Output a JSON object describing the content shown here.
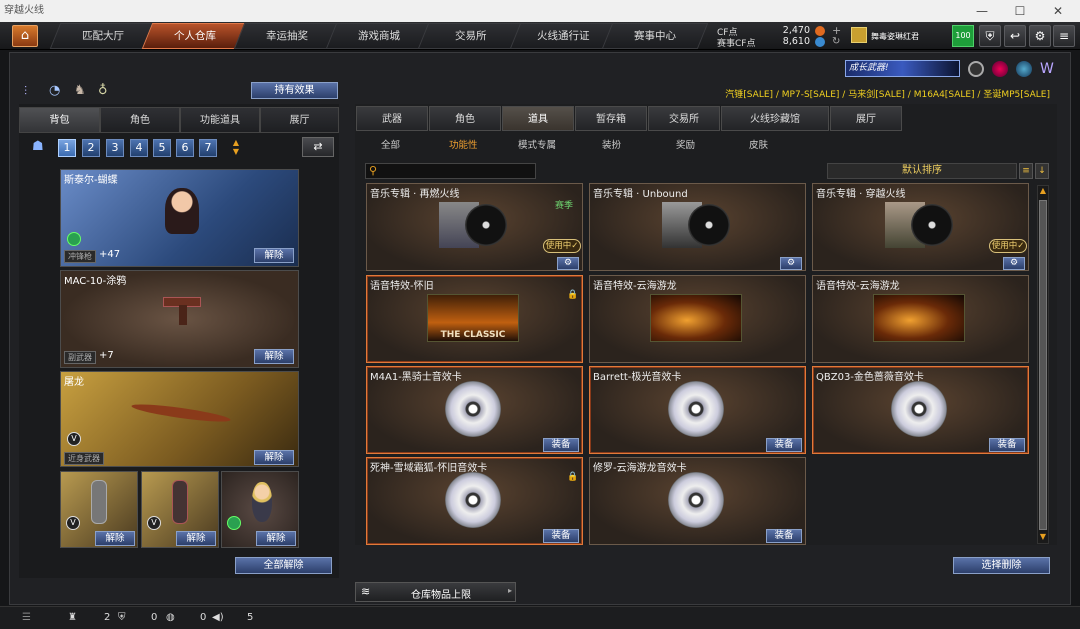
{
  "window": {
    "title": "穿越火线"
  },
  "nav": {
    "tabs": [
      "匹配大厅",
      "个人仓库",
      "幸运抽奖",
      "游戏商城",
      "交易所",
      "火线通行证",
      "赛事中心"
    ],
    "active_index": 1
  },
  "currency": {
    "cf_label": "CF点",
    "cf_value": "2,470",
    "match_label": "赛事CF点",
    "match_value": "8,610"
  },
  "user": {
    "name": "舞毒姿琳红君",
    "level": "100"
  },
  "promo": {
    "banner_text": "成长武器!",
    "sale_ticker": "汽锤[SALE] / MP7-S[SALE] / 马来剑[SALE] / M16A4[SALE] / 圣诞MP5[SALE]"
  },
  "left": {
    "effects_button": "持有效果",
    "tabs": [
      "背包",
      "角色",
      "功能道具",
      "展厅"
    ],
    "active_tab": 0,
    "pages": [
      "1",
      "2",
      "3",
      "4",
      "5",
      "6",
      "7"
    ],
    "slots": [
      {
        "title": "斯泰尔-蝴蝶",
        "tag": "冲锋枪",
        "bonus": "+47",
        "button": "解除"
      },
      {
        "title": "MAC-10-涂鸦",
        "tag": "副武器",
        "bonus": "+7",
        "button": "解除"
      },
      {
        "title": "屠龙",
        "tag": "近身武器",
        "bonus": "",
        "button": "解除"
      }
    ],
    "small_slots": [
      {
        "button": "解除"
      },
      {
        "button": "解除"
      },
      {
        "button": "解除"
      }
    ],
    "release_all": "全部解除"
  },
  "right": {
    "tabs": [
      "武器",
      "角色",
      "道具",
      "暂存箱",
      "交易所",
      "火线珍藏馆",
      "展厅"
    ],
    "active_tab": 2,
    "filters": [
      "全部",
      "功能性",
      "模式专属",
      "装扮",
      "奖励",
      "皮肤"
    ],
    "active_filter": 1,
    "search_placeholder": "",
    "sort_label": "默认排序",
    "items": [
      {
        "title": "音乐专辑 · 再燃火线",
        "badge": "赛季",
        "status": "使用中✓",
        "type": "album"
      },
      {
        "title": "音乐专辑 · Unbound",
        "badge": "",
        "status": "",
        "type": "album"
      },
      {
        "title": "音乐专辑 · 穿越火线",
        "badge": "",
        "status": "使用中✓",
        "type": "album"
      },
      {
        "title": "语音特效-怀旧",
        "badge": "",
        "status": "",
        "type": "voice",
        "art_text": "THE CLASSIC"
      },
      {
        "title": "语音特效-云海游龙",
        "badge": "",
        "status": "",
        "type": "voice"
      },
      {
        "title": "语音特效-云海游龙",
        "badge": "",
        "status": "",
        "type": "voice"
      },
      {
        "title": "M4A1-黑骑士音效卡",
        "button": "装备",
        "type": "cd"
      },
      {
        "title": "Barrett-极光音效卡",
        "button": "装备",
        "type": "cd"
      },
      {
        "title": "QBZ03-金色蔷薇音效卡",
        "button": "装备",
        "type": "cd"
      },
      {
        "title": "死神-雪域霜狐-怀旧音效卡",
        "button": "装备",
        "type": "cd"
      },
      {
        "title": "修罗-云海游龙音效卡",
        "button": "装备",
        "type": "cd"
      }
    ],
    "select_delete": "选择删除",
    "capacity_label": "仓库物品上限"
  },
  "status_bar": {
    "friends": "2",
    "guild": "0",
    "chat": "0",
    "volume": "5"
  }
}
